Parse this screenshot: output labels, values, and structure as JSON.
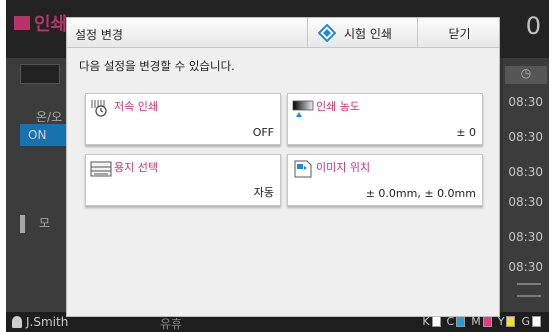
{
  "background": {
    "app_title": "인쇄",
    "job_count": "0",
    "onoff_label": "온/오",
    "on_button": "ON",
    "mode_label": "모",
    "times": [
      "08:30",
      "08:30",
      "08:30",
      "08:30",
      "08:30",
      "08:30"
    ],
    "user": "J.Smith",
    "status": "유휴",
    "inks": [
      {
        "label": "K",
        "color": "#ffffff"
      },
      {
        "label": "C",
        "color": "#1ea0dc"
      },
      {
        "label": "M",
        "color": "#e0407f"
      },
      {
        "label": "Y",
        "color": "#f0e020"
      },
      {
        "label": "G",
        "color": "#ffffff"
      }
    ]
  },
  "dialog": {
    "title": "설정 변경",
    "test_print_label": "시험 인쇄",
    "close_label": "닫기",
    "description": "다음 설정을 변경할 수 있습니다.",
    "tiles": [
      {
        "label": "저속 인쇄",
        "value": "OFF",
        "icon": "slow-print-icon"
      },
      {
        "label": "인쇄 농도",
        "value": "± 0",
        "icon": "print-density-icon"
      },
      {
        "label": "용지 선택",
        "value": "자동",
        "icon": "paper-tray-icon"
      },
      {
        "label": "이미지 위치",
        "value": "± 0.0mm, ± 0.0mm",
        "icon": "image-position-icon"
      }
    ]
  },
  "colors": {
    "accent_pink": "#d3306f",
    "accent_blue": "#1d8cd6"
  }
}
